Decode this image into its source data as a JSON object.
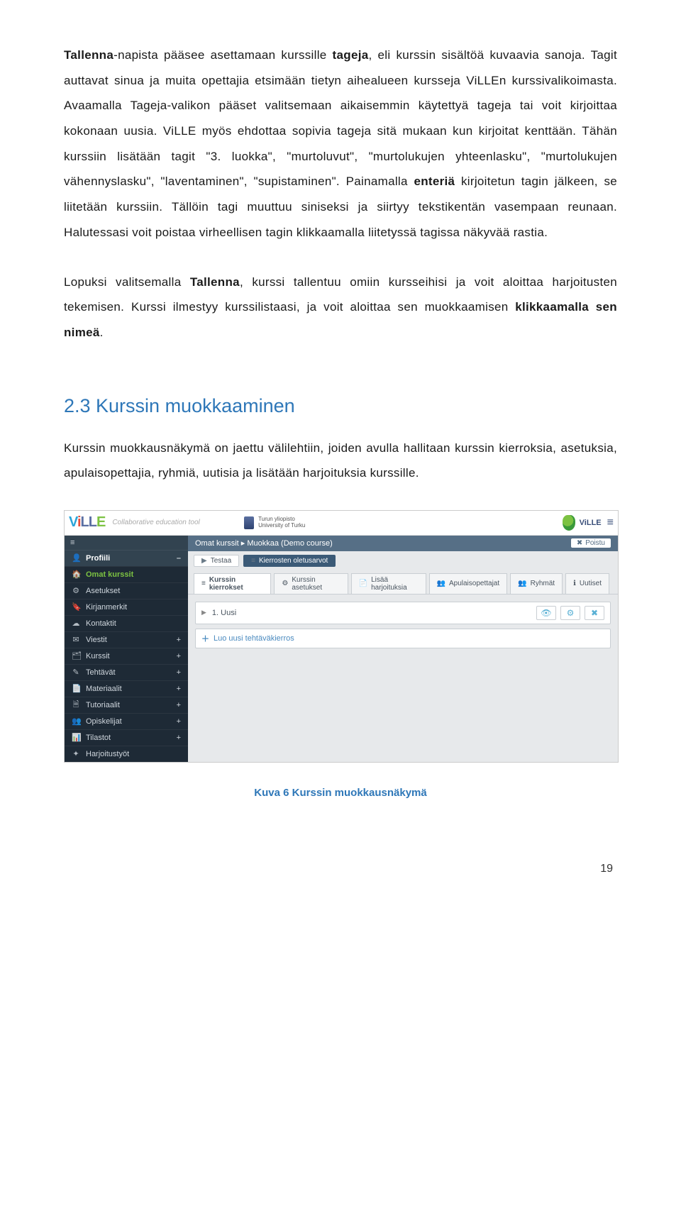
{
  "para1": "<b>Tallenna</b>-napista pääsee asettamaan kurssille <b>tageja</b>, eli kurssin sisältöä kuvaavia sanoja. Tagit auttavat sinua ja muita opettajia etsimään tietyn aihealueen kursseja ViLLEn kurssivalikoimasta. Avaamalla Tageja-valikon pääset valitsemaan aikaisemmin käytettyä tageja tai voit kirjoittaa kokonaan uusia. ViLLE myös ehdottaa sopivia tageja sitä mukaan kun kirjoitat kenttään. Tähän kurssiin lisätään tagit \"3. luokka\", \"murtoluvut\", \"murtolukujen yhteenlasku\", \"murtolukujen vähennyslasku\", \"laventaminen\", \"supistaminen\". Painamalla <b>enteriä</b> kirjoitetun tagin jälkeen, se liitetään kurssiin. Tällöin tagi muuttuu siniseksi ja siirtyy tekstikentän vasempaan reunaan. Halutessasi voit poistaa virheellisen tagin klikkaamalla liitetyssä tagissa näkyvää rastia.",
  "para2": "Lopuksi valitsemalla <b>Tallenna</b>, kurssi tallentuu omiin kursseihisi ja voit aloittaa harjoitusten tekemisen. Kurssi ilmestyy kurssilistaasi, ja voit aloittaa sen muokkaamisen <b>klikkaamalla sen nimeä</b>.",
  "section_heading": "2.3 Kurssin muokkaaminen",
  "para3": "Kurssin muokkausnäkymä on jaettu välilehtiin, joiden avulla hallitaan kurssin kierroksia, asetuksia, apulaisopettajia, ryhmiä, uutisia ja lisätään harjoituksia kurssille.",
  "shot": {
    "collab": "Collaborative education tool",
    "uni_line1": "Turun yliopisto",
    "uni_line2": "University of Turku",
    "ville_mark": "ViLLE",
    "sidebar_items": [
      {
        "icon": "≡",
        "label": "",
        "sel": false,
        "ham": true
      },
      {
        "icon": "👤",
        "label": "Profiili",
        "sel": true,
        "minus": true
      },
      {
        "icon": "🏠",
        "label": "Omat kurssit",
        "sel": false,
        "highlight": true
      },
      {
        "icon": "⚙",
        "label": "Asetukset",
        "sel": false
      },
      {
        "icon": "🔖",
        "label": "Kirjanmerkit",
        "sel": false
      },
      {
        "icon": "☁",
        "label": "Kontaktit",
        "sel": false
      },
      {
        "icon": "✉",
        "label": "Viestit",
        "sel": false,
        "plus": true
      },
      {
        "icon": "🗂",
        "label": "Kurssit",
        "sel": false,
        "plus": true
      },
      {
        "icon": "✎",
        "label": "Tehtävät",
        "sel": false,
        "plus": true
      },
      {
        "icon": "📄",
        "label": "Materiaalit",
        "sel": false,
        "plus": true
      },
      {
        "icon": "🗎",
        "label": "Tutoriaalit",
        "sel": false,
        "plus": true
      },
      {
        "icon": "👥",
        "label": "Opiskelijat",
        "sel": false,
        "plus": true
      },
      {
        "icon": "📊",
        "label": "Tilastot",
        "sel": false,
        "plus": true
      },
      {
        "icon": "✦",
        "label": "Harjoitustyöt",
        "sel": false
      }
    ],
    "breadcrumb": "Omat kurssit ▸ Muokkaa (Demo course)",
    "exit": "Poistu",
    "top_buttons": [
      {
        "icon": "▶",
        "label": "Testaa",
        "blue": false
      },
      {
        "icon": "≡",
        "label": "Kierrosten oletusarvot",
        "blue": true
      }
    ],
    "tabs": [
      {
        "icon": "≡",
        "label": "Kurssin kierrokset",
        "active": true
      },
      {
        "icon": "⚙",
        "label": "Kurssin asetukset"
      },
      {
        "icon": "📄",
        "label": "Lisää harjoituksia"
      },
      {
        "icon": "👥",
        "label": "Apulaisopettajat"
      },
      {
        "icon": "👥",
        "label": "Ryhmät"
      },
      {
        "icon": "ℹ",
        "label": "Uutiset"
      }
    ],
    "row_title": "1. Uusi",
    "row_icons": [
      "👁",
      "⚙",
      "✖"
    ],
    "add_row": "Luo uusi tehtäväkierros"
  },
  "caption": "Kuva 6 Kurssin muokkausnäkymä",
  "page_number": "19"
}
